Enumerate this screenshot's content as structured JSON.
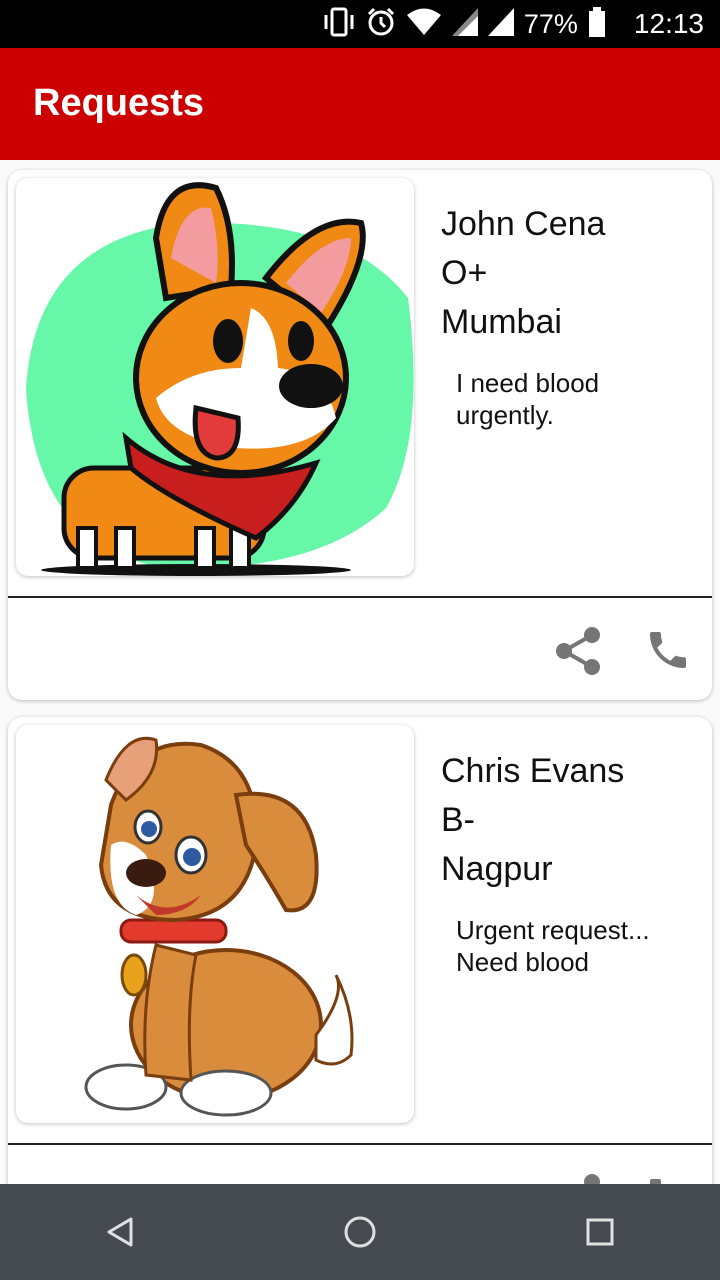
{
  "status_bar": {
    "battery": "77%",
    "time": "12:13",
    "icons": [
      "vibrate-icon",
      "alarm-icon",
      "wifi-icon",
      "signal-icon",
      "signal-icon",
      "battery-icon"
    ]
  },
  "app_bar": {
    "title": "Requests"
  },
  "requests": [
    {
      "name": "John Cena",
      "blood_group": "O+",
      "city": "Mumbai",
      "message_line1": "I need blood",
      "message_line2": "urgently."
    },
    {
      "name": "Chris Evans",
      "blood_group": "B-",
      "city": "Nagpur",
      "message_line1": "Urgent request...",
      "message_line2": "Need blood"
    }
  ],
  "actions": {
    "share_icon": "share-icon",
    "call_icon": "phone-icon"
  },
  "nav_bar": {
    "icons": [
      "back-icon",
      "home-icon",
      "recents-icon"
    ]
  },
  "colors": {
    "app_bar": "#cc0000",
    "status_bar": "#000000",
    "nav_bar": "#454a50",
    "icon_gray": "#757575"
  }
}
